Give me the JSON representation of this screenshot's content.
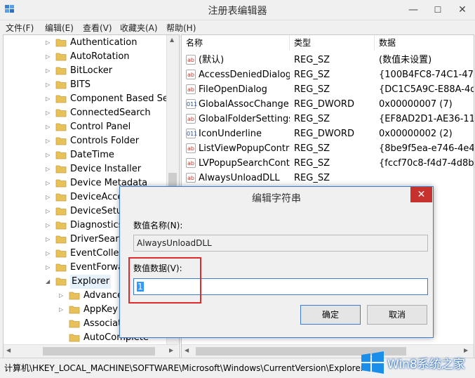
{
  "window": {
    "title": "注册表编辑器",
    "min": "—",
    "max": "☐",
    "close": "✕"
  },
  "menu": [
    "文件(F)",
    "编辑(E)",
    "查看(V)",
    "收藏夹(A)",
    "帮助(H)"
  ],
  "tree": [
    {
      "label": "Authentication",
      "level": 0,
      "expander": "right"
    },
    {
      "label": "AutoRotation",
      "level": 0,
      "expander": "right"
    },
    {
      "label": "BitLocker",
      "level": 0,
      "expander": "right"
    },
    {
      "label": "BITS",
      "level": 0,
      "expander": "right"
    },
    {
      "label": "Component Based Serv",
      "level": 0,
      "expander": "right"
    },
    {
      "label": "ConnectedSearch",
      "level": 0,
      "expander": "right"
    },
    {
      "label": "Control Panel",
      "level": 0,
      "expander": "right"
    },
    {
      "label": "Controls Folder",
      "level": 0,
      "expander": "right"
    },
    {
      "label": "DateTime",
      "level": 0,
      "expander": "right"
    },
    {
      "label": "Device Installer",
      "level": 0,
      "expander": "right"
    },
    {
      "label": "Device Metadata",
      "level": 0,
      "expander": "right"
    },
    {
      "label": "DeviceAcces",
      "level": 0,
      "expander": "right"
    },
    {
      "label": "DeviceSetup",
      "level": 0,
      "expander": "right"
    },
    {
      "label": "Diagnostics",
      "level": 0,
      "expander": "right"
    },
    {
      "label": "DriverSearch",
      "level": 0,
      "expander": "right"
    },
    {
      "label": "EventCollect",
      "level": 0,
      "expander": "right"
    },
    {
      "label": "EventForwar",
      "level": 0,
      "expander": "right"
    },
    {
      "label": "Explorer",
      "level": 0,
      "expander": "down"
    },
    {
      "label": "Advanced",
      "level": 1,
      "expander": "right"
    },
    {
      "label": "AppKey",
      "level": 1,
      "expander": "right"
    },
    {
      "label": "Associatio",
      "level": 1,
      "expander": "none"
    },
    {
      "label": "AutoComplete",
      "level": 1,
      "expander": "none"
    }
  ],
  "list": {
    "headers": [
      "名称",
      "类型",
      "数据"
    ],
    "rows": [
      {
        "name": "(默认)",
        "type": "REG_SZ",
        "data": "(数值未设置)",
        "kind": "sz"
      },
      {
        "name": "AccessDeniedDialog",
        "type": "REG_SZ",
        "data": "{100B4FC8-74C1-470F-",
        "kind": "sz"
      },
      {
        "name": "FileOpenDialog",
        "type": "REG_SZ",
        "data": "{DC1C5A9C-E88A-4dd-",
        "kind": "sz"
      },
      {
        "name": "GlobalAssocChange...",
        "type": "REG_DWORD",
        "data": "0x00000007 (7)",
        "kind": "dw"
      },
      {
        "name": "GlobalFolderSettings",
        "type": "REG_SZ",
        "data": "{EF8AD2D1-AE36-11D1",
        "kind": "sz"
      },
      {
        "name": "IconUnderline",
        "type": "REG_DWORD",
        "data": "0x00000002 (2)",
        "kind": "dw"
      },
      {
        "name": "ListViewPopupControl",
        "type": "REG_SZ",
        "data": "{8be9f5ea-e746-4e47-",
        "kind": "sz"
      },
      {
        "name": "LVPopupSearchCont...",
        "type": "REG_SZ",
        "data": "{fccf70c8-f4d7-4d8b-8",
        "kind": "sz"
      },
      {
        "name": "AlwaysUnloadDLL",
        "type": "REG_SZ",
        "data": "",
        "kind": "sz"
      }
    ]
  },
  "status": {
    "path": "计算机\\HKEY_LOCAL_MACHINE\\SOFTWARE\\Microsoft\\Windows\\CurrentVersion\\Explorer"
  },
  "dialog": {
    "title": "编辑字符串",
    "close": "✕",
    "name_label": "数值名称(N):",
    "name_value": "AlwaysUnloadDLL",
    "data_label": "数值数据(V):",
    "data_value": "1",
    "ok": "确定",
    "cancel": "取消"
  },
  "watermark": {
    "text": "Win8系统之家"
  },
  "colors": {
    "accent": "#3b7bd4",
    "highlight_box": "#e02b2b",
    "close_red": "#c7312e"
  }
}
